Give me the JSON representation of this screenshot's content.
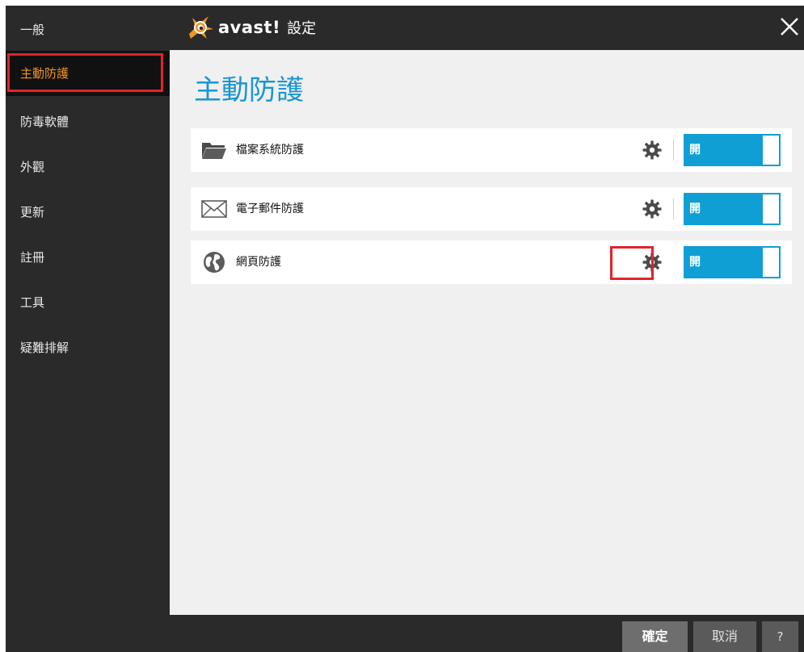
{
  "header": {
    "brand": "avast!",
    "title": "設定"
  },
  "sidebar": {
    "items": [
      {
        "label": "一般",
        "active": false
      },
      {
        "label": "主動防護",
        "active": true
      },
      {
        "label": "防毒軟體",
        "active": false
      },
      {
        "label": "外觀",
        "active": false
      },
      {
        "label": "更新",
        "active": false
      },
      {
        "label": "註冊",
        "active": false
      },
      {
        "label": "工具",
        "active": false
      },
      {
        "label": "疑難排解",
        "active": false
      }
    ]
  },
  "main": {
    "title": "主動防護",
    "shields": [
      {
        "label": "檔案系統防護",
        "icon": "folder-icon",
        "toggle_label": "開"
      },
      {
        "label": "電子郵件防護",
        "icon": "envelope-icon",
        "toggle_label": "開"
      },
      {
        "label": "網頁防護",
        "icon": "globe-icon",
        "toggle_label": "開"
      }
    ]
  },
  "footer": {
    "ok_label": "確定",
    "cancel_label": "取消",
    "help_label": "?"
  },
  "colors": {
    "accent": "#1996d1",
    "toggle": "#0f9fd4",
    "active_nav_text": "#f29221",
    "highlight": "#e0242b"
  }
}
